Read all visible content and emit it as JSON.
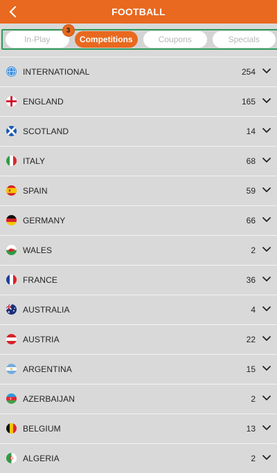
{
  "header": {
    "title": "FOOTBALL"
  },
  "tabs": [
    {
      "label": "In-Play",
      "active": false
    },
    {
      "label": "Competitions",
      "active": true,
      "badge": "3"
    },
    {
      "label": "Coupons",
      "active": false
    },
    {
      "label": "Specials",
      "active": false
    }
  ],
  "countries": [
    {
      "name": "INTERNATIONAL",
      "count": "254",
      "icon": "globe-icon"
    },
    {
      "name": "ENGLAND",
      "count": "165",
      "icon": "england-flag-icon"
    },
    {
      "name": "SCOTLAND",
      "count": "14",
      "icon": "scotland-flag-icon"
    },
    {
      "name": "ITALY",
      "count": "68",
      "icon": "italy-flag-icon"
    },
    {
      "name": "SPAIN",
      "count": "59",
      "icon": "spain-flag-icon"
    },
    {
      "name": "GERMANY",
      "count": "66",
      "icon": "germany-flag-icon"
    },
    {
      "name": "WALES",
      "count": "2",
      "icon": "wales-flag-icon"
    },
    {
      "name": "FRANCE",
      "count": "36",
      "icon": "france-flag-icon"
    },
    {
      "name": "AUSTRALIA",
      "count": "4",
      "icon": "australia-flag-icon"
    },
    {
      "name": "AUSTRIA",
      "count": "22",
      "icon": "austria-flag-icon"
    },
    {
      "name": "ARGENTINA",
      "count": "15",
      "icon": "argentina-flag-icon"
    },
    {
      "name": "AZERBAIJAN",
      "count": "2",
      "icon": "azerbaijan-flag-icon"
    },
    {
      "name": "BELGIUM",
      "count": "13",
      "icon": "belgium-flag-icon"
    },
    {
      "name": "ALGERIA",
      "count": "2",
      "icon": "algeria-flag-icon"
    }
  ],
  "colors": {
    "accent": "#e8691f",
    "tab_border": "#2e9a5a",
    "background": "#d9d9d9"
  }
}
